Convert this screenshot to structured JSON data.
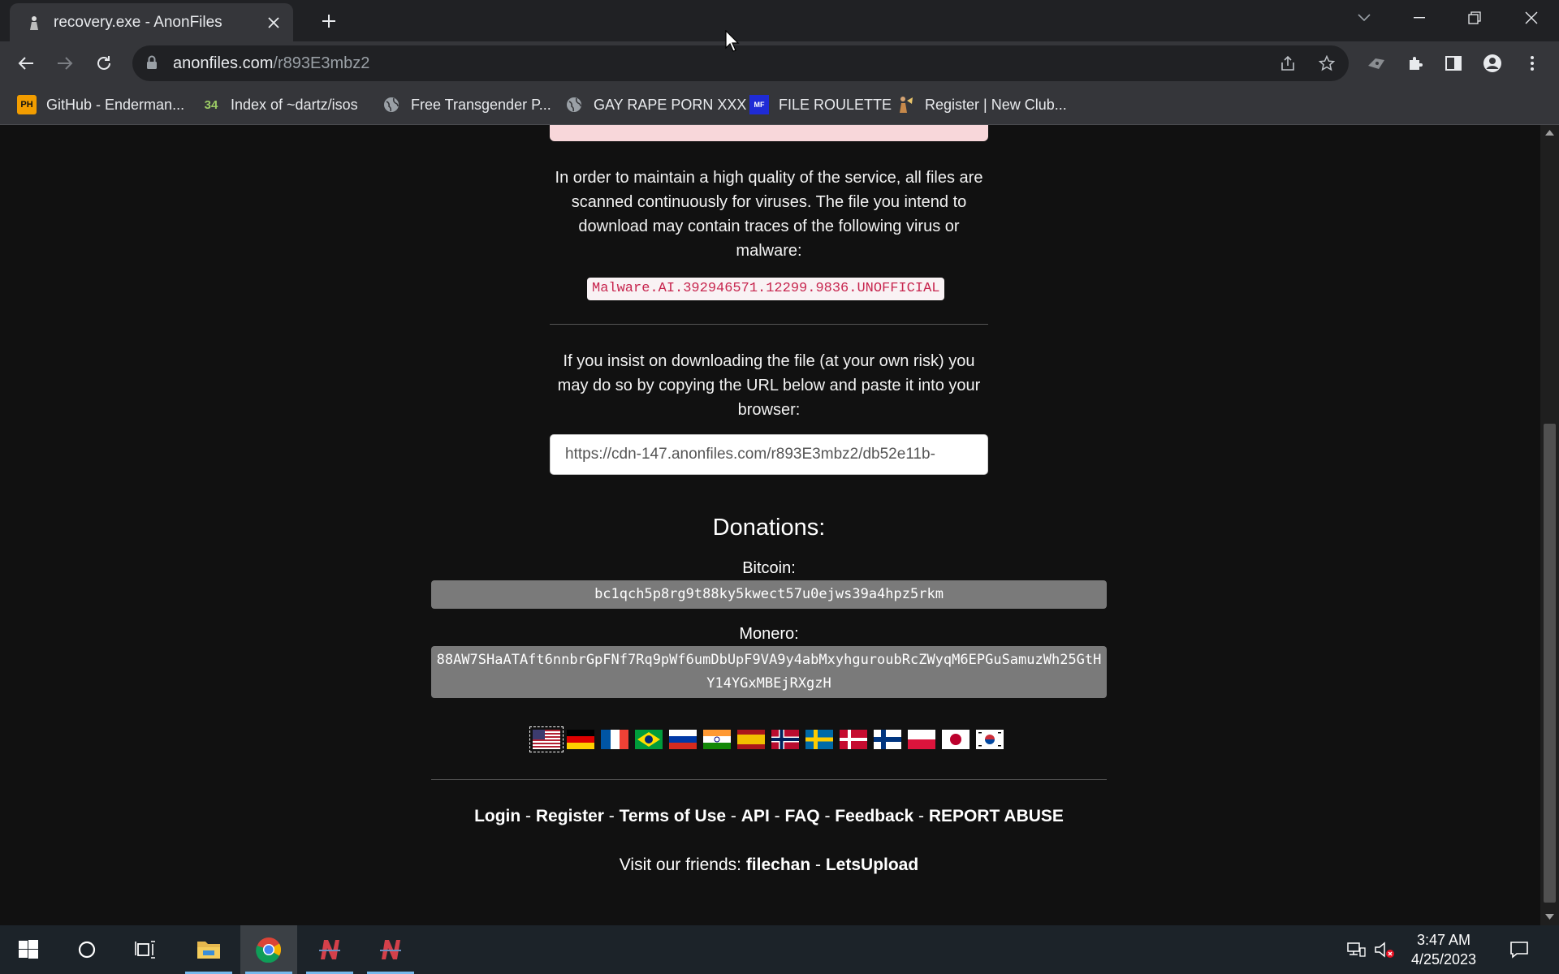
{
  "browser": {
    "tab": {
      "title": "recovery.exe - AnonFiles"
    },
    "address": {
      "host": "anonfiles.com",
      "path": "/r893E3mbz2"
    },
    "bookmarks": [
      {
        "label": "GitHub - Enderman...",
        "icon": "PH"
      },
      {
        "label": "Index of ~dartz/isos",
        "icon": "34"
      },
      {
        "label": "Free Transgender P...",
        "icon": "globe-icon"
      },
      {
        "label": "GAY RAPE PORN XXX",
        "icon": "globe-icon"
      },
      {
        "label": "FILE ROULETTE",
        "icon": "MF"
      },
      {
        "label": "Register | New Club...",
        "icon": "figure-icon"
      }
    ]
  },
  "page": {
    "intro": "In order to maintain a high quality of the service, all files are scanned continuously for viruses. The file you intend to download may contain traces of the following virus or malware:",
    "virus_name": "Malware.AI.392946571.12299.9836.UNOFFICIAL",
    "insist": "If you insist on downloading the file (at your own risk) you may do so by copying the URL below and paste it into your browser:",
    "download_url": "https://cdn-147.anonfiles.com/r893E3mbz2/db52e11b-",
    "donations": {
      "title": "Donations:",
      "bitcoin_label": "Bitcoin:",
      "bitcoin_address": "bc1qch5p8rg9t88ky5kwect57u0ejws39a4hpz5rkm",
      "monero_label": "Monero:",
      "monero_address": "88AW7SHaATAft6nnbrGpFNf7Rq9pWf6umDbUpF9VA9y4abMxyhguroubRcZWyqM6EPGuSamuzWh25GtHY14YGxMBEjRXgzH"
    },
    "languages": [
      "us",
      "de",
      "fr",
      "br",
      "ru",
      "in",
      "es",
      "no",
      "se",
      "dk",
      "fi",
      "pl",
      "jp",
      "kr"
    ],
    "footer": {
      "login": "Login",
      "register": "Register",
      "terms": "Terms of Use",
      "api": "API",
      "faq": "FAQ",
      "feedback": "Feedback",
      "report": "REPORT ABUSE",
      "separator": " - ",
      "friends_prefix": "Visit our friends: ",
      "friend1": "filechan",
      "friend2": "LetsUpload"
    }
  },
  "taskbar": {
    "time": "3:47 AM",
    "date": "4/25/2023"
  }
}
